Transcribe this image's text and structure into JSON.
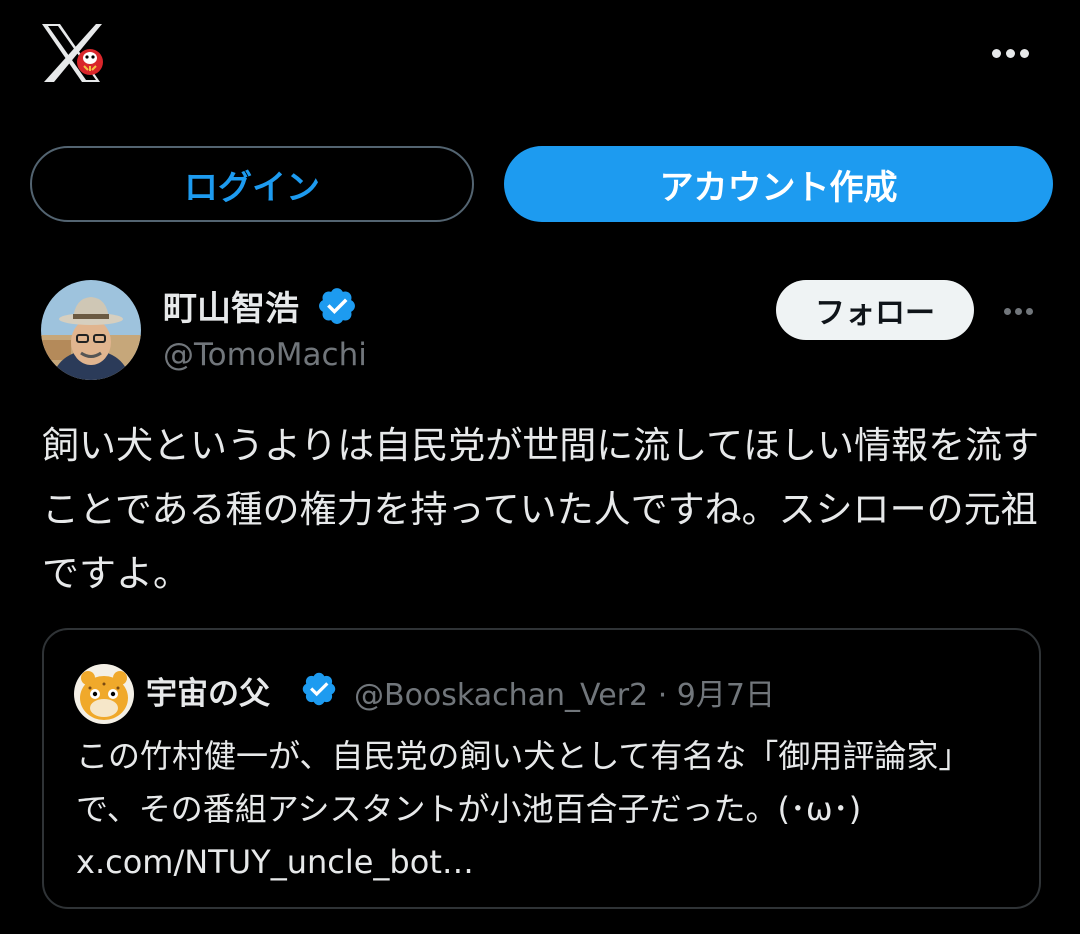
{
  "header": {
    "logo_icon": "x-logo-with-daruma-icon",
    "more_icon": "more-horizontal-icon"
  },
  "auth": {
    "login_label": "ログイン",
    "signup_label": "アカウント作成"
  },
  "tweet": {
    "author_name": "町山智浩",
    "author_handle": "@TomoMachi",
    "follow_label": "フォロー",
    "text": "飼い犬というよりは自民党が世間に流してほしい情報を流すことである種の権力を持っていた人ですね。スシローの元祖ですよ。"
  },
  "quote": {
    "author_name": "宇宙の父",
    "author_handle": "@Booskachan_Ver2",
    "separator": "·",
    "date": "9月7日",
    "text": "この竹村健一が、自民党の飼い犬として有名な「御用評論家」で、その番組アシスタントが小池百合子だった。(･ω･) x.com/NTUY_uncle_bot…"
  },
  "colors": {
    "accent": "#1d9bf0",
    "background": "#000000",
    "text": "#e7e9ea",
    "muted": "#71767b",
    "border": "#2f3336"
  }
}
